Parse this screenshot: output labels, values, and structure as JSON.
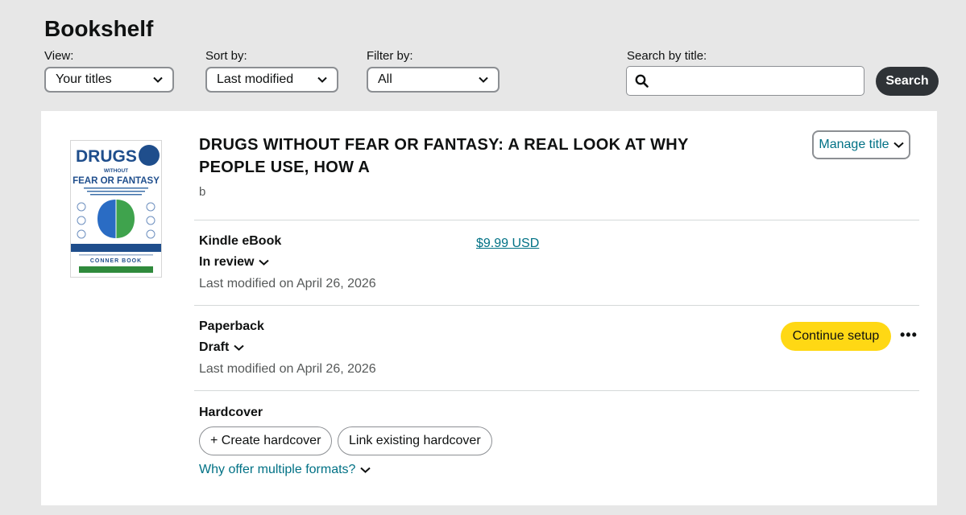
{
  "header": {
    "title": "Bookshelf",
    "view": {
      "label": "View:",
      "value": "Your titles"
    },
    "sort": {
      "label": "Sort by:",
      "value": "Last modified"
    },
    "filter": {
      "label": "Filter by:",
      "value": "All"
    },
    "search": {
      "label": "Search by title:",
      "placeholder": "",
      "button": "Search"
    }
  },
  "book": {
    "title": "DRUGS WITHOUT FEAR OR FANTASY: A REAL LOOK AT WHY PEOPLE USE, HOW A",
    "author": "b",
    "manage_label": "Manage title",
    "cover": {
      "line1": "DRUGS",
      "line2": "WITHOUT",
      "line3": "FEAR OR FANTASY",
      "author": "CONNER BOOK"
    },
    "formats": [
      {
        "name": "Kindle eBook",
        "status": "In review",
        "modified": "Last modified on April 26, 2026",
        "price": "$9.99 USD"
      },
      {
        "name": "Paperback",
        "status": "Draft",
        "modified": "Last modified on April 26, 2026",
        "action": "Continue setup",
        "more": "•••"
      },
      {
        "name": "Hardcover",
        "create": "+ Create hardcover",
        "link": "Link existing hardcover"
      }
    ],
    "why_label": "Why offer multiple formats?"
  },
  "colors": {
    "accent": "#007185",
    "cta": "#ffd814",
    "dark_button": "#2f3337",
    "cover_blue": "#1f4e8c"
  }
}
